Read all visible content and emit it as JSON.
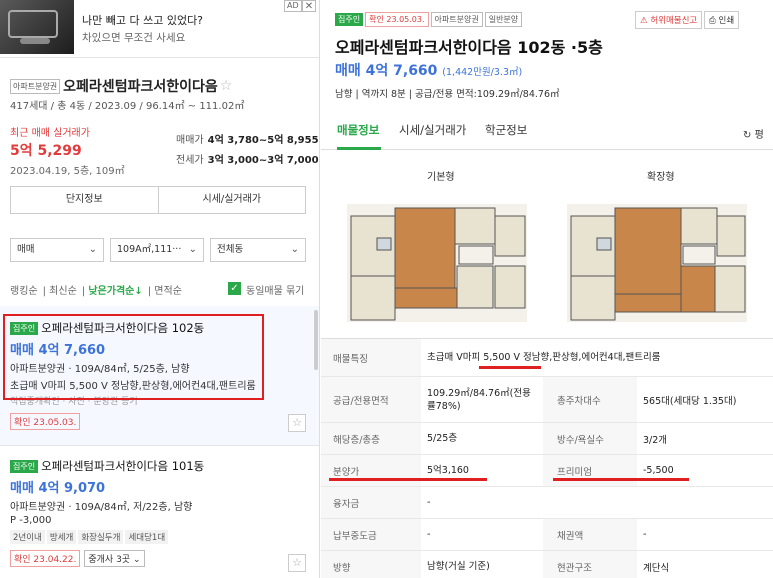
{
  "ad": {
    "title": "나만 빼고 다 쓰고 있었다?",
    "subtitle": "차있으면 무조건 사세요",
    "badge": "AD",
    "close": "✕"
  },
  "complex": {
    "type_tag": "아파트분양권",
    "name": "오페라센텀파크서한이다음",
    "info": "417세대 / 총 4동 / 2023.09 / 96.14㎡ ~ 111.02㎡",
    "recent_label": "최근 매매 실거래가",
    "recent_price": "5억 5,299",
    "recent_date": "2023.04.19, 5층, 109㎡",
    "sale_label": "매매가",
    "sale_range": "4억 3,780~5억 8,955",
    "jeonse_label": "전세가",
    "jeonse_range": "3억 3,000~3억 7,000",
    "btn_info": "단지정보",
    "btn_price": "시세/실거래가"
  },
  "filters": {
    "trade": "매매",
    "area": "109A㎡,111···",
    "dong": "전체동"
  },
  "sorts": {
    "rank": "랭킹순",
    "latest": "최신순",
    "low_price": "낮은가격순↓",
    "area": "면적순",
    "group": "동일매물 묶기"
  },
  "listings": [
    {
      "badge": "집주인",
      "name": "오페라센텀파크서한이다음 102동",
      "price": "매매 4억 7,660",
      "line1": "아파트분양권 · 109A/84㎡, 5/25층, 남향",
      "line2": "초급매 V마피 5,500 V 정남향,판상형,에어컨4대,팬트리룸",
      "line3": "직접중개확인 · 사진 · 분양권 등기",
      "confirm": "확인 23.05.03."
    },
    {
      "badge": "집주인",
      "name": "오페라센텀파크서한이다음 101동",
      "price": "매매 4억 9,070",
      "line1": "아파트분양권 · 109A/84㎡, 저/22층, 남향",
      "line2": "P -3,000",
      "tags": [
        "2년이내",
        "방세개",
        "화장실두개",
        "세대당1대"
      ],
      "confirm": "확인 23.04.22.",
      "agents": "중개사 3곳"
    }
  ],
  "detail": {
    "tags": [
      "집주인",
      "확인 23.05.03.",
      "아파트분양권",
      "일반분양"
    ],
    "title": "오페라센텀파크서한이다음 102동 ·5층",
    "price": "매매 4억 7,660",
    "price_per": "(1,442만원/3.3㎡)",
    "info": "남향  |  역까지 8분  |  공급/전용 면적:109.29㎡/84.76㎡",
    "report": "허위매물신고",
    "print": "인쇄",
    "tabs": [
      "매물정보",
      "시세/실거래가",
      "학군정보"
    ],
    "refresh": "평",
    "floorplan_basic": "기본형",
    "floorplan_ext": "확장형"
  },
  "table": [
    {
      "k": "매물특징",
      "v": "초급매 V마피 5,500 V 정남향,판상형,에어컨4대,팬트리룸"
    },
    {
      "k": "공급/전용면적",
      "v": "109.29㎡/84.76㎡(전용률78%)",
      "k2": "총주차대수",
      "v2": "565대(세대당 1.35대)"
    },
    {
      "k": "해당층/총층",
      "v": "5/25층",
      "k2": "방수/욕실수",
      "v2": "3/2개"
    },
    {
      "k": "분양가",
      "v": "5억3,160",
      "k2": "프리미엄",
      "v2": "-5,500"
    },
    {
      "k": "융자금",
      "v": "-"
    },
    {
      "k": "납부중도금",
      "v": "-",
      "k2": "채권액",
      "v2": "-"
    },
    {
      "k": "방향",
      "v": "남향(거실 기준)",
      "k2": "현관구조",
      "v2": "계단식"
    }
  ]
}
